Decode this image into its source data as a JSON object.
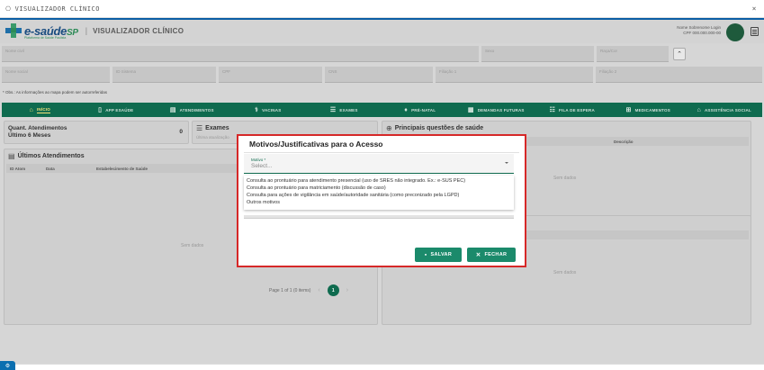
{
  "window": {
    "title": "VISUALIZADOR CLÍNICO",
    "close_glyph": "×"
  },
  "header": {
    "brand_main": "e-saúde",
    "brand_suffix": "SP",
    "tagline": "Plataforma de Saúde Paulista",
    "separator": "|",
    "app_title": "VISUALIZADOR CLÍNICO",
    "user_name": "Nome Sobrenome Login",
    "user_cpf": "CPF 000.000.000-00"
  },
  "patient_fields": {
    "nome_civil": "Nome civil",
    "sexo": "Sexo",
    "raca_cor": "Raça/Cor",
    "nome_social": "Nome social",
    "id_sistema": "ID Sistema",
    "cpf": "CPF",
    "cns": "CNS",
    "filiacao1": "Filiação 1",
    "filiacao2": "Filiação 2"
  },
  "obs_note": "* Obs.: As informações ao mapa podem ser autorreferidas",
  "nav": [
    {
      "icon": "⌂",
      "label": "INÍCIO",
      "active": true
    },
    {
      "icon": "▯",
      "label": "APP ESAÚDE"
    },
    {
      "icon": "▤",
      "label": "ATENDIMENTOS"
    },
    {
      "icon": "⚕",
      "label": "VACINAS"
    },
    {
      "icon": "☰",
      "label": "EXAMES"
    },
    {
      "icon": "♦",
      "label": "PRÉ-NATAL"
    },
    {
      "icon": "▦",
      "label": "DEMANDAS FUTURAS"
    },
    {
      "icon": "☷",
      "label": "FILA DE ESPERA"
    },
    {
      "icon": "⊞",
      "label": "MEDICAMENTOS"
    },
    {
      "icon": "⌂",
      "label": "ASSISTÊNCIA SOCIAL"
    }
  ],
  "atendimentos_card": {
    "title_line1": "Quant. Atendimentos",
    "title_line2": "Último 6 Meses",
    "count": "0"
  },
  "exames_card": {
    "title": "Exames",
    "subtitle": "Última atualização"
  },
  "questoes_card": {
    "title": "Principais questões de saúde",
    "col_descricao": "Descrição",
    "empty": "Sem dados"
  },
  "ultimos_card": {
    "title": "Últimos Atendimentos",
    "col_id": "ID Atom",
    "col_data": "Data",
    "col_estab": "Estabelecimento de Saúde",
    "empty": "Sem dados"
  },
  "lower_right_card": {
    "empty": "Sem dados"
  },
  "pager": {
    "text": "Page 1 of 1 (0 items)",
    "prev": "‹",
    "current": "1",
    "next": "›"
  },
  "modal": {
    "title": "Motivos/Justificativas para o Acesso",
    "select_label": "Motivo *",
    "select_placeholder": "Select...",
    "options": [
      "Consulta ao prontuário para atendimento presencial (uso de SRES não integrado. Ex.: e-SUS PEC)",
      "Consulta ao prontuário para matriciamento (discussão de caso)",
      "Consulta para ações de vigilância em saúde/autoridade sanitária (como preconizado pela LGPD)",
      "Outros motivos"
    ],
    "save_label": "SALVAR",
    "close_label": "FECHAR"
  },
  "fab": {
    "glyph": "⚙"
  }
}
